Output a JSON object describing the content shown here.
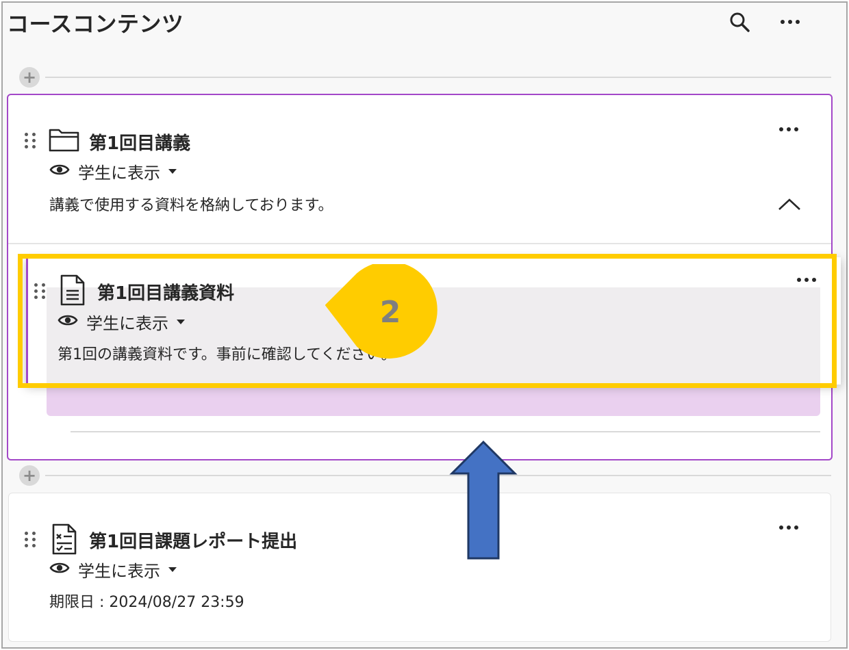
{
  "header": {
    "title": "コースコンテンツ",
    "search_icon": "search-icon",
    "more_icon": "more-horizontal-icon"
  },
  "folder": {
    "title": "第1回目講義",
    "icon": "folder-icon",
    "visibility": "学生に表示",
    "description": "講義で使用する資料を格納しております。",
    "expanded": true
  },
  "dragged_item": {
    "title": "第1回目講義資料",
    "icon": "document-icon",
    "visibility": "学生に表示",
    "description": "第1回の講義資料です。事前に確認してください。"
  },
  "callout": {
    "number": "2"
  },
  "assignment": {
    "title": "第1回目課題レポート提出",
    "icon": "assignment-icon",
    "visibility": "学生に表示",
    "due": "期限日 : 2024/08/27 23:59"
  },
  "colors": {
    "accent_purple": "#a347c8",
    "highlight_yellow": "#ffcc00",
    "arrow_blue": "#4472c4",
    "arrow_outline": "#1f3864",
    "drop_zone": "#ead0ef"
  }
}
